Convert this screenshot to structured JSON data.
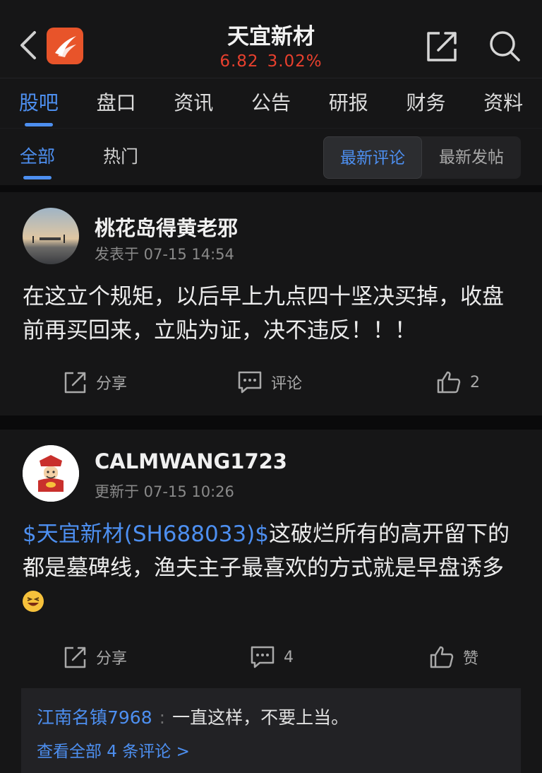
{
  "header": {
    "title": "天宜新材",
    "price": "6.82",
    "change_pct": "3.02%",
    "price_color": "#e8402e",
    "back_icon": "chevron-left-icon",
    "share_icon": "share-icon",
    "search_icon": "search-icon"
  },
  "tabs": [
    {
      "label": "股吧",
      "active": true
    },
    {
      "label": "盘口"
    },
    {
      "label": "资讯"
    },
    {
      "label": "公告"
    },
    {
      "label": "研报"
    },
    {
      "label": "财务"
    },
    {
      "label": "资料"
    }
  ],
  "subtabs": {
    "all": "全部",
    "hot": "热门",
    "sort_latest_comment": "最新评论",
    "sort_latest_post": "最新发帖"
  },
  "accent_color": "#4d8ff0",
  "posts": [
    {
      "author": "桃花岛得黄老邪",
      "meta": "发表于 07-15 14:54",
      "content": "在这立个规矩，以后早上九点四十坚决买掉，收盘前再买回来，立贴为证，决不违反！！！",
      "share_label": "分享",
      "comment_label": "评论",
      "like_label": "2"
    },
    {
      "author": "CALMWANG1723",
      "meta": "更新于 07-15 10:26",
      "stock_link": "$天宜新材(SH688033)$",
      "content": "这破烂所有的高开留下的都是墓碑线，渔夫主子最喜欢的方式就是早盘诱多",
      "emoji_icon": "grinning-squint-emoji-icon",
      "share_label": "分享",
      "comment_label": "4",
      "like_label": "赞",
      "top_comment": {
        "user": "江南名镇7968",
        "separator": ":",
        "text": "一直这样，不要上当。",
        "more": "查看全部 4 条评论 >"
      }
    }
  ]
}
